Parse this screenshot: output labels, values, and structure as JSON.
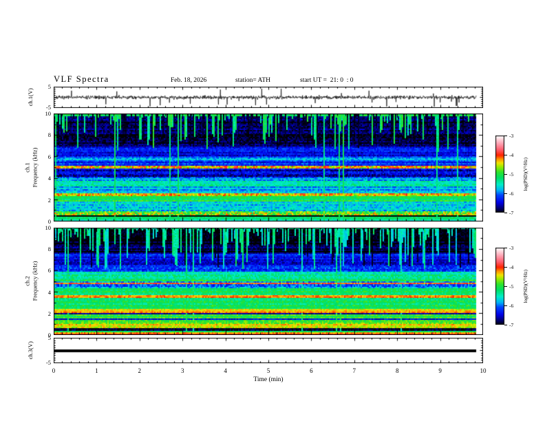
{
  "figure": {
    "title": "VLF Spectra",
    "date": "Feb. 18, 2026",
    "station": "station= ATH",
    "start_ut": "start UT =  21: 0  : 0"
  },
  "x_axis": {
    "label": "Time (min)",
    "ticks": [
      0,
      1,
      2,
      3,
      4,
      5,
      6,
      7,
      8,
      9,
      10
    ],
    "minor_step": 0.2,
    "range": [
      0,
      10
    ]
  },
  "panels": {
    "ch1_wave": {
      "ylabel": "ch.1(V)",
      "yticks": [
        "5",
        "-5"
      ],
      "y_range": [
        -5,
        5
      ]
    },
    "ch1_spec": {
      "ylabel_line1": "ch.1",
      "ylabel_line2": "Frequency (kHz)",
      "yticks": [
        10,
        8,
        6,
        4,
        2,
        0
      ],
      "y_range": [
        0,
        10
      ]
    },
    "ch2_spec": {
      "ylabel_line1": "ch.2",
      "ylabel_line2": "Frequency (kHz)",
      "yticks": [
        10,
        8,
        6,
        4,
        2,
        0
      ],
      "y_range": [
        0,
        10
      ]
    },
    "ch3_wave": {
      "ylabel": "ch.3(V)",
      "yticks": [
        "5",
        "-5"
      ],
      "y_range": [
        -5,
        5
      ]
    }
  },
  "colorbar": {
    "label": "log(PSD)(V²/Hz)",
    "ticks": [
      -3,
      -4,
      -5,
      -6,
      -7
    ],
    "range": [
      -7,
      -3
    ]
  },
  "palette": [
    [
      -7.05,
      "#000000"
    ],
    [
      -6.8,
      "#00006e"
    ],
    [
      -6.5,
      "#0000e6"
    ],
    [
      -6.1,
      "#0048ff"
    ],
    [
      -5.85,
      "#00b4f5"
    ],
    [
      -5.55,
      "#00eec8"
    ],
    [
      -5.2,
      "#00e066"
    ],
    [
      -4.9,
      "#2ee42e"
    ],
    [
      -4.62,
      "#9cec00"
    ],
    [
      -4.42,
      "#f2e400"
    ],
    [
      -4.22,
      "#ff9500"
    ],
    [
      -4.02,
      "#ff2400"
    ],
    [
      -3.72,
      "#ff5f70"
    ],
    [
      -3.4,
      "#ffa4b4"
    ],
    [
      -3.0,
      "#ffffff"
    ]
  ],
  "chart_data": [
    {
      "id": "ch1_waveform",
      "type": "line",
      "ylabel": "ch.1(V)",
      "x_range": [
        0,
        10
      ],
      "y_range": [
        -5,
        5
      ],
      "end_time_min": 9.85,
      "description": "broadband noise ~±1 V around 0 with impulsive spikes to ±4.5 V",
      "gen": {
        "seed": 7,
        "samples": 1500,
        "sigma": 0.55,
        "spike_prob": 0.022,
        "spike_min": 1.8,
        "spike_max": 4.5,
        "down_fraction": 0.62
      }
    },
    {
      "id": "ch1_spectrogram",
      "type": "heatmap",
      "ylabel": "ch.1 Frequency (kHz)",
      "x_range": [
        0,
        10
      ],
      "y_range": [
        0,
        10
      ],
      "z_label": "log(PSD)(V²/Hz)",
      "z_range": [
        -7,
        -3
      ],
      "end_time_min": 9.85,
      "gen": {
        "seed": 11,
        "row_noise": 0.5,
        "bands": [
          {
            "f0": 9.75,
            "f1": 10.06,
            "level": -5.15,
            "noise": 0.5
          },
          {
            "f0": 7.0,
            "f1": 9.75,
            "level": -6.85,
            "noise": 0.45
          },
          {
            "f0": 6.1,
            "f1": 7.0,
            "level": -6.45,
            "noise": 0.5
          },
          {
            "f0": 5.6,
            "f1": 6.1,
            "level": -6.0,
            "noise": 0.55
          },
          {
            "f0": 5.12,
            "f1": 5.6,
            "level": -6.25,
            "noise": 0.5
          },
          {
            "f0": 4.88,
            "f1": 5.12,
            "level": -4.35,
            "noise": 1.1
          },
          {
            "f0": 4.15,
            "f1": 4.88,
            "level": -6.55,
            "noise": 0.6
          },
          {
            "f0": 3.75,
            "f1": 4.15,
            "level": -5.95,
            "noise": 0.6
          },
          {
            "f0": 3.3,
            "f1": 3.75,
            "level": -5.45,
            "noise": 0.5
          },
          {
            "f0": 2.45,
            "f1": 3.3,
            "level": -5.75,
            "noise": 0.55
          },
          {
            "f0": 1.9,
            "f1": 2.45,
            "level": -5.05,
            "noise": 0.45
          },
          {
            "f0": 0.95,
            "f1": 1.9,
            "level": -5.7,
            "noise": 0.6
          },
          {
            "f0": 0.55,
            "f1": 0.95,
            "level": -4.75,
            "noise": 1.2
          },
          {
            "f0": 0.0,
            "f1": 0.55,
            "level": -7.1,
            "noise": 0.3
          }
        ],
        "lines": [
          {
            "f": 2.5,
            "level": -4.4,
            "noise": 0.9,
            "width": 0.12
          },
          {
            "f": 0.32,
            "level": -5.2,
            "noise": 0.4,
            "width": 0.1
          },
          {
            "f": 0.14,
            "level": -5.6,
            "noise": 0.4,
            "width": 0.08
          }
        ],
        "streak_zone": {
          "f_min": 6.3,
          "f_top": 9.8,
          "bright_prob": 0.4,
          "black_prob": 0.2,
          "level": -5.2,
          "level_jitter": 0.5,
          "extent_min": 6.4,
          "pow": 1.6
        },
        "full_streaks": {
          "count": 10,
          "level": -5.25
        }
      }
    },
    {
      "id": "ch2_spectrogram",
      "type": "heatmap",
      "ylabel": "ch.2 Frequency (kHz)",
      "x_range": [
        0,
        10
      ],
      "y_range": [
        0,
        10
      ],
      "z_label": "log(PSD)(V²/Hz)",
      "z_range": [
        -7,
        -3
      ],
      "end_time_min": 9.85,
      "gen": {
        "seed": 29,
        "row_noise": 0.5,
        "bands": [
          {
            "f0": 9.85,
            "f1": 10.06,
            "level": -5.3,
            "noise": 0.4
          },
          {
            "f0": 7.55,
            "f1": 9.85,
            "level": -6.95,
            "noise": 0.4
          },
          {
            "f0": 6.4,
            "f1": 7.55,
            "level": -6.4,
            "noise": 0.5
          },
          {
            "f0": 5.85,
            "f1": 6.4,
            "level": -6.1,
            "noise": 0.6
          },
          {
            "f0": 5.3,
            "f1": 5.85,
            "level": -5.5,
            "noise": 0.6
          },
          {
            "f0": 4.95,
            "f1": 5.3,
            "level": -5.15,
            "noise": 0.5
          },
          {
            "f0": 4.4,
            "f1": 4.95,
            "level": -5.9,
            "noise": 0.8
          },
          {
            "f0": 4.05,
            "f1": 4.4,
            "level": -5.0,
            "noise": 0.45
          },
          {
            "f0": 3.7,
            "f1": 4.05,
            "level": -5.2,
            "noise": 0.5
          },
          {
            "f0": 3.45,
            "f1": 3.7,
            "level": -4.5,
            "noise": 0.6
          },
          {
            "f0": 2.45,
            "f1": 3.45,
            "level": -5.15,
            "noise": 0.5
          },
          {
            "f0": 2.0,
            "f1": 2.45,
            "level": -4.45,
            "noise": 0.5
          },
          {
            "f0": 1.15,
            "f1": 2.0,
            "level": -5.05,
            "noise": 0.5
          },
          {
            "f0": 0.6,
            "f1": 1.15,
            "level": -4.7,
            "noise": 0.6
          },
          {
            "f0": 0.0,
            "f1": 0.6,
            "level": -6.9,
            "noise": 0.5
          }
        ],
        "lines": [
          {
            "f": 4.84,
            "level": -4.15,
            "noise": 0.6,
            "width": 0.1
          },
          {
            "f": 3.57,
            "level": -4.2,
            "noise": 0.4,
            "width": 0.14
          },
          {
            "f": 2.2,
            "level": -4.3,
            "noise": 0.4,
            "width": 0.12
          },
          {
            "f": 1.98,
            "level": -6.6,
            "noise": 0.4,
            "width": 0.08
          },
          {
            "f": 1.45,
            "level": -6.4,
            "noise": 0.5,
            "width": 0.08
          },
          {
            "f": 0.95,
            "level": -4.35,
            "noise": 0.5,
            "width": 0.1
          },
          {
            "f": 0.8,
            "level": -4.5,
            "noise": 0.5,
            "width": 0.08
          },
          {
            "f": 0.35,
            "level": -5.1,
            "noise": 0.4,
            "width": 0.09
          },
          {
            "f": 0.18,
            "level": -4.25,
            "noise": 0.5,
            "width": 0.08
          },
          {
            "f": 0.05,
            "level": -4.1,
            "noise": 0.3,
            "width": 0.06
          }
        ],
        "streak_zone": {
          "f_min": 5.9,
          "f_top": 9.9,
          "bright_prob": 0.5,
          "black_prob": 0.22,
          "level": -5.45,
          "level_jitter": 0.6,
          "extent_min": 6.1,
          "pow": 1.4
        },
        "full_streaks": {
          "count": 8,
          "level": -5.4
        }
      }
    },
    {
      "id": "ch3_waveform",
      "type": "line",
      "ylabel": "ch.3(V)",
      "x_range": [
        0,
        10
      ],
      "y_range": [
        -5,
        5
      ],
      "end_time_min": 9.85,
      "description": "flat (dead channel) thick line at 0 V",
      "constant_value": 0,
      "line_thickness_px": 4
    }
  ]
}
